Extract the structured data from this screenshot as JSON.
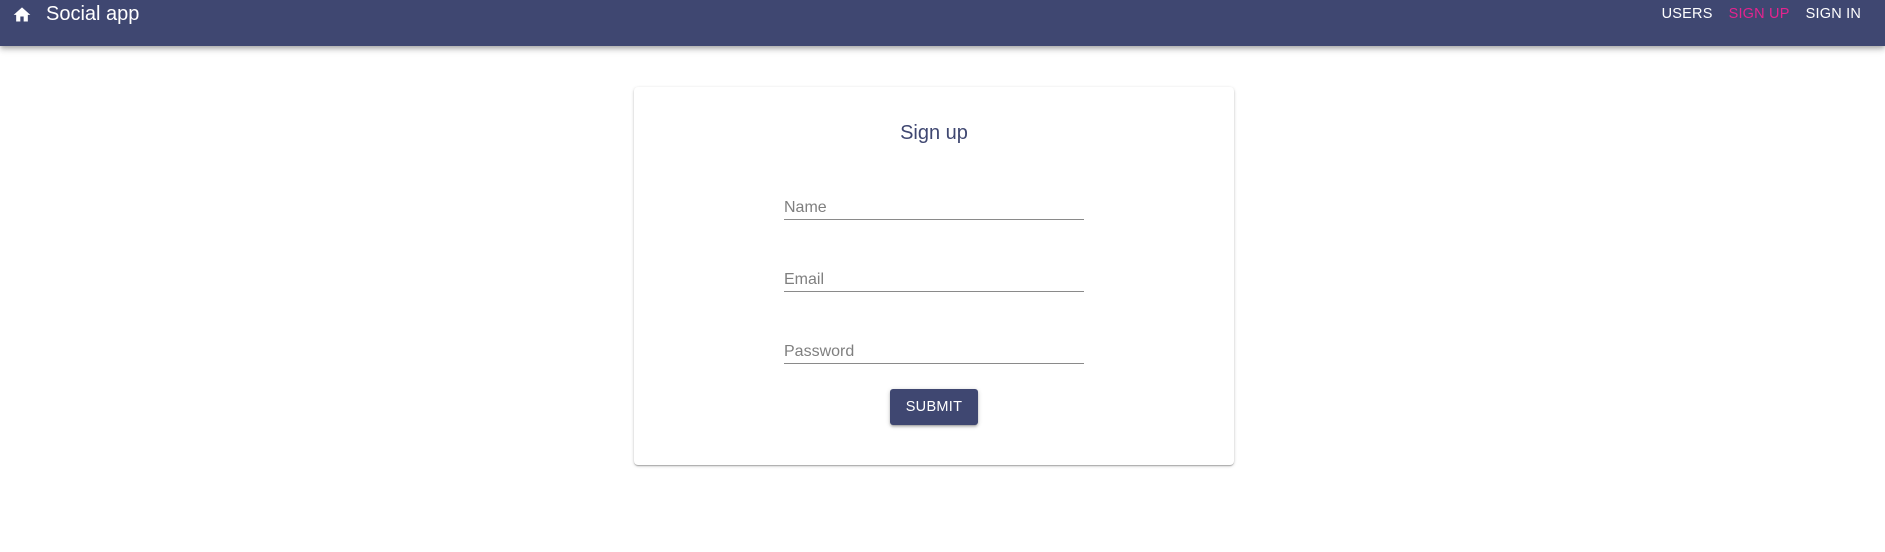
{
  "header": {
    "home_icon": "home-icon",
    "title": "Social app",
    "nav": {
      "users": "USERS",
      "signup": "SIGN UP",
      "signin": "SIGN IN"
    },
    "active_color": "#e5238f",
    "bar_color": "#3f4771"
  },
  "form": {
    "title": "Sign up",
    "name": {
      "placeholder": "Name",
      "value": ""
    },
    "email": {
      "placeholder": "Email",
      "value": ""
    },
    "password": {
      "placeholder": "Password",
      "value": ""
    },
    "submit_label": "SUBMIT"
  }
}
